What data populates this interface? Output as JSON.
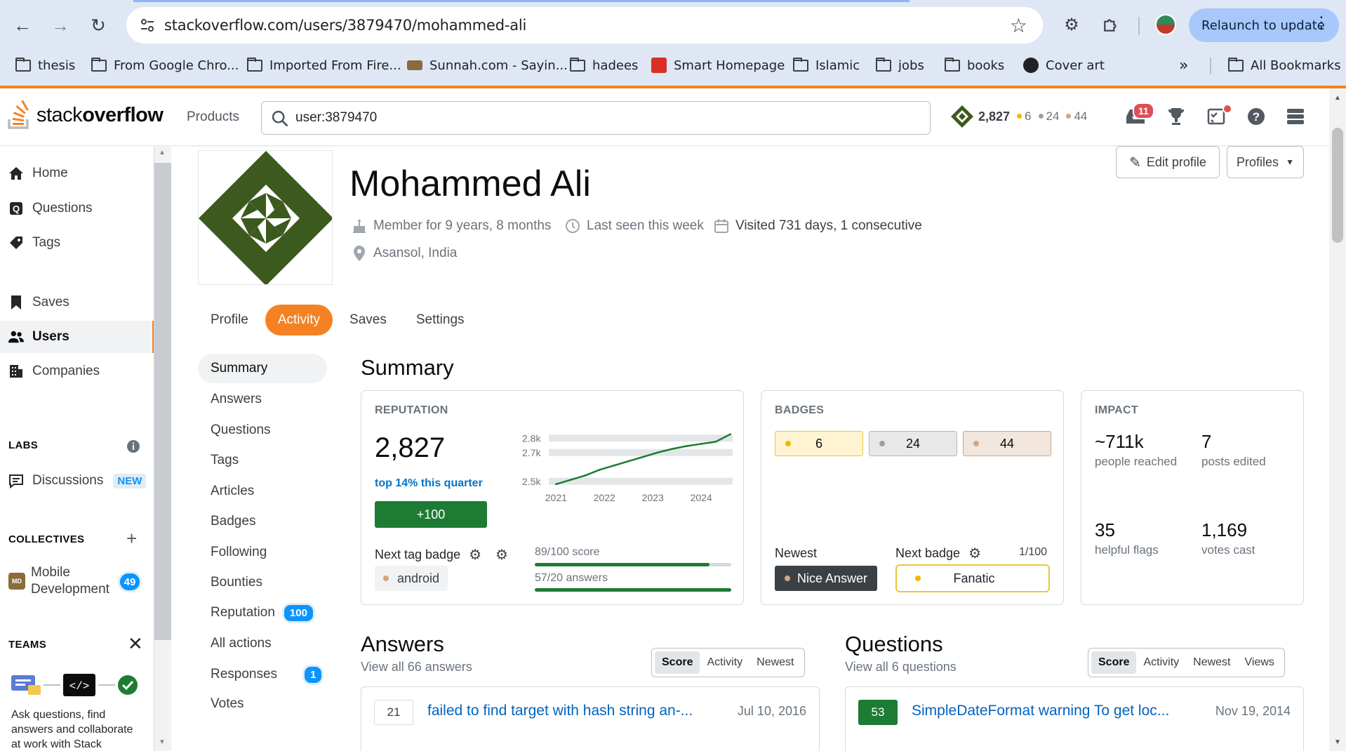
{
  "browser": {
    "url": "stackoverflow.com/users/3879470/mohammed-ali",
    "relaunch_label": "Relaunch to update",
    "bookmarks": [
      "thesis",
      "From Google Chro...",
      "Imported From Fire...",
      "Sunnah.com - Sayin...",
      "hadees",
      "Smart Homepage",
      "Islamic",
      "jobs",
      "books",
      "Cover art"
    ],
    "overflow_label": "»",
    "all_bookmarks_label": "All Bookmarks"
  },
  "topbar": {
    "logo_light": "stack",
    "logo_bold": "overflow",
    "products_label": "Products",
    "search_value": "user:3879470",
    "reputation": "2,827",
    "gold": "6",
    "silver": "24",
    "bronze": "44",
    "inbox_count": "11"
  },
  "left_nav": {
    "home": "Home",
    "questions": "Questions",
    "tags": "Tags",
    "saves": "Saves",
    "users": "Users",
    "companies": "Companies",
    "labs_heading": "LABS",
    "discussions": "Discussions",
    "new_tag": "NEW",
    "collectives_heading": "COLLECTIVES",
    "collective_abbr": "MD",
    "collective_name_line1": "Mobile",
    "collective_name_line2": "Development",
    "collective_count": "49",
    "teams_heading": "TEAMS",
    "teams_promo_line1": "Ask questions, find",
    "teams_promo_line2": "answers and collaborate",
    "teams_promo_line3": "at work with Stack"
  },
  "profile": {
    "name": "Mohammed Ali",
    "member_for": "Member for 9 years, 8 months",
    "last_seen": "Last seen this week",
    "visited": "Visited 731 days, 1 consecutive",
    "location": "Asansol, India",
    "edit_profile_label": "Edit profile",
    "profiles_label": "Profiles",
    "tabs": [
      "Profile",
      "Activity",
      "Saves",
      "Settings"
    ]
  },
  "activity_nav": {
    "items": [
      "Summary",
      "Answers",
      "Questions",
      "Tags",
      "Articles",
      "Badges",
      "Following",
      "Bounties",
      "Reputation",
      "All actions",
      "Responses",
      "Votes"
    ],
    "reputation_count": "100",
    "responses_count": "1"
  },
  "summary": {
    "title": "Summary",
    "reputation": {
      "label": "REPUTATION",
      "value": "2,827",
      "top_text": "top 14% this quarter",
      "plus_label": "+100",
      "next_tag_badge_label": "Next tag badge",
      "tag": "android",
      "score_progress_label": "89/100 score",
      "score_progress": 0.89,
      "answers_progress_label": "57/20 answers",
      "answers_progress": 1.0
    },
    "badges": {
      "label": "BADGES",
      "gold": "6",
      "silver": "24",
      "bronze": "44",
      "newest_label": "Newest",
      "newest_badge": "Nice Answer",
      "next_badge_label": "Next badge",
      "next_badge_progress": "1/100",
      "next_badge": "Fanatic"
    },
    "impact": {
      "label": "IMPACT",
      "people_reached_value": "~711k",
      "people_reached_label": "people reached",
      "posts_edited_value": "7",
      "posts_edited_label": "posts edited",
      "helpful_flags_value": "35",
      "helpful_flags_label": "helpful flags",
      "votes_cast_value": "1,169",
      "votes_cast_label": "votes cast"
    }
  },
  "answers": {
    "title": "Answers",
    "view_all": "View all 66 answers",
    "sort_options": [
      "Score",
      "Activity",
      "Newest"
    ],
    "first_score": "21",
    "first_title": "failed to find target with hash string an-...",
    "first_date": "Jul 10, 2016"
  },
  "questions": {
    "title": "Questions",
    "view_all": "View all 6 questions",
    "sort_options": [
      "Score",
      "Activity",
      "Newest",
      "Views"
    ],
    "first_score": "53",
    "first_title": "SimpleDateFormat warning To get loc...",
    "first_date": "Nov 19, 2014"
  },
  "colors": {
    "so_orange": "#f48225",
    "gold": "#f1b600",
    "silver": "#9a9fa5",
    "bronze": "#d1a684",
    "green": "#1e7b34",
    "link_blue": "#0063bf"
  },
  "chart_data": {
    "type": "line",
    "title": "",
    "x": [
      2021.0,
      2021.3,
      2021.6,
      2021.9,
      2022.2,
      2022.5,
      2022.8,
      2023.1,
      2023.4,
      2023.7,
      2024.0,
      2024.3,
      2024.6
    ],
    "series": [
      {
        "values": [
          2480,
          2510,
          2540,
          2580,
          2610,
          2640,
          2670,
          2700,
          2725,
          2745,
          2760,
          2775,
          2827
        ]
      }
    ],
    "x_ticks": [
      "2021",
      "2022",
      "2023",
      "2024"
    ],
    "y_ticks": [
      "2.5k",
      "2.7k",
      "2.8k"
    ],
    "ylim": [
      2450,
      2850
    ],
    "xlabel": "",
    "ylabel": ""
  }
}
